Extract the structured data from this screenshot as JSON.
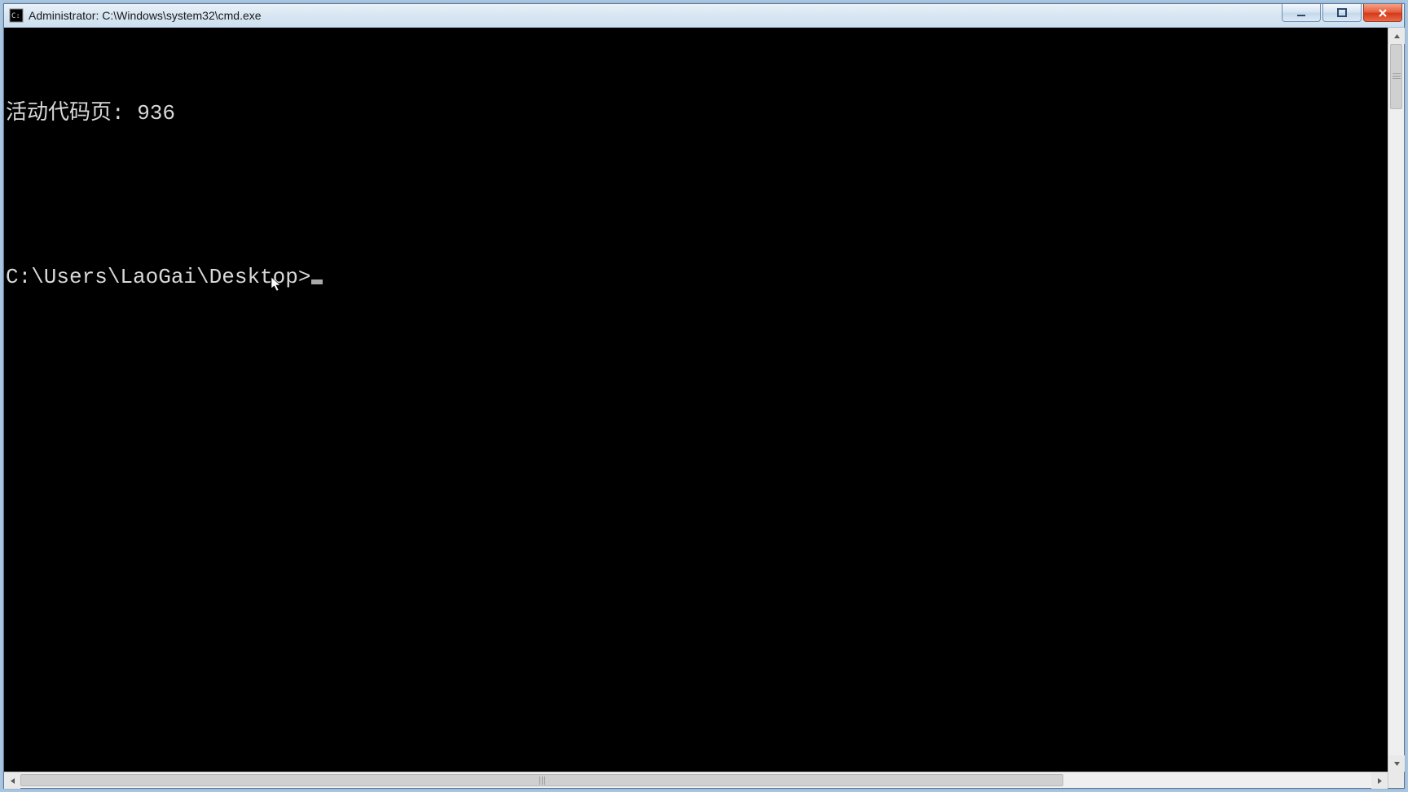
{
  "window": {
    "title": "Administrator: C:\\Windows\\system32\\cmd.exe"
  },
  "terminal": {
    "line1": "活动代码页: 936",
    "blank": "",
    "prompt": "C:\\Users\\LaoGai\\Desktop>"
  }
}
